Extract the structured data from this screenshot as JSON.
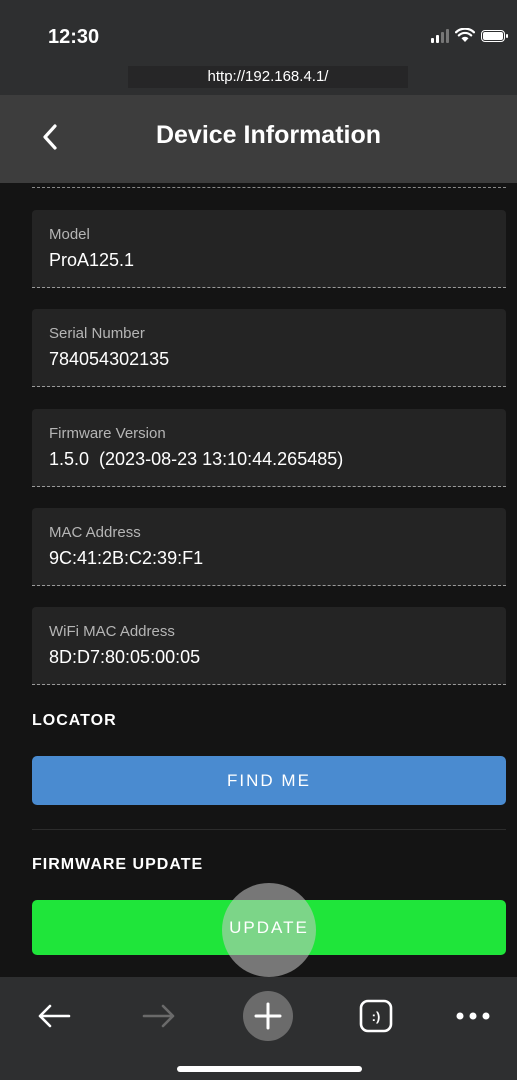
{
  "status_bar": {
    "time": "12:30"
  },
  "browser": {
    "url": "http://192.168.4.1/"
  },
  "header": {
    "title": "Device Information",
    "back_icon": "chevron-left-icon"
  },
  "info_fields": [
    {
      "label": "Model",
      "value": "ProA125.1"
    },
    {
      "label": "Serial Number",
      "value": "784054302135"
    },
    {
      "label": "Firmware Version",
      "value": "1.5.0  (2023-08-23 13:10:44.265485)"
    },
    {
      "label": "MAC Address",
      "value": "9C:41:2B:C2:39:F1"
    },
    {
      "label": "WiFi MAC Address",
      "value": "8D:D7:80:05:00:05"
    }
  ],
  "locator": {
    "title": "LOCATOR",
    "button_label": "FIND ME",
    "button_color": "#4a8bd0"
  },
  "firmware_update": {
    "title": "FIRMWARE UPDATE",
    "button_label": "UPDATE",
    "button_color": "#1fe53a"
  },
  "bottom_nav": {
    "icons": [
      "arrow-left-icon",
      "arrow-right-icon",
      "plus-icon",
      "tabs-icon",
      "more-icon"
    ],
    "tabs_glyph": ":)"
  }
}
